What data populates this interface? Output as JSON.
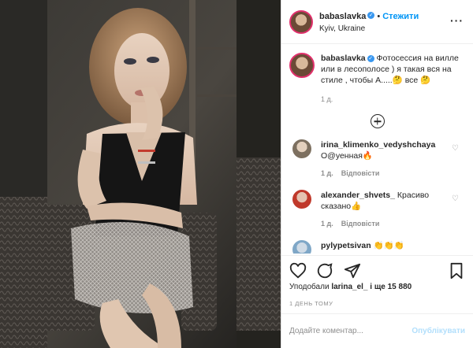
{
  "post": {
    "username": "babaslavka",
    "follow_label": "Стежити",
    "location": "Kyiv, Ukraine"
  },
  "caption": {
    "username": "babaslavka",
    "text": "Фотосессия на вилле или в лесополосе ) я такая вся на стиле , чтобы А.....🤔 все 🤔",
    "age": "1 д."
  },
  "comments": [
    {
      "username": "irina_klimenko_vedyshchaya",
      "text": "О@уенная🔥",
      "age": "1 д.",
      "reply_label": "Відповісти",
      "avatar_color": "#9a9080"
    },
    {
      "username": "alexander_shvets_",
      "text": "Красиво сказано👍",
      "age": "1 д.",
      "reply_label": "Відповісти",
      "avatar_color": "#c0392b"
    },
    {
      "username": "pylypetsivan",
      "text": "👏👏👏",
      "avatar_color": "#7fa7c7"
    }
  ],
  "likes": {
    "prefix": "Уподобали",
    "user": "larina_el_",
    "suffix": "і ще 15 880"
  },
  "timestamp": "1 ДЕНЬ ТОМУ",
  "add_comment": {
    "placeholder": "Додайте коментар...",
    "post_label": "Опублікувати"
  },
  "colors": {
    "accent": "#0095f6",
    "post_disabled": "#b2dffc",
    "muted": "#8e8e8e"
  }
}
